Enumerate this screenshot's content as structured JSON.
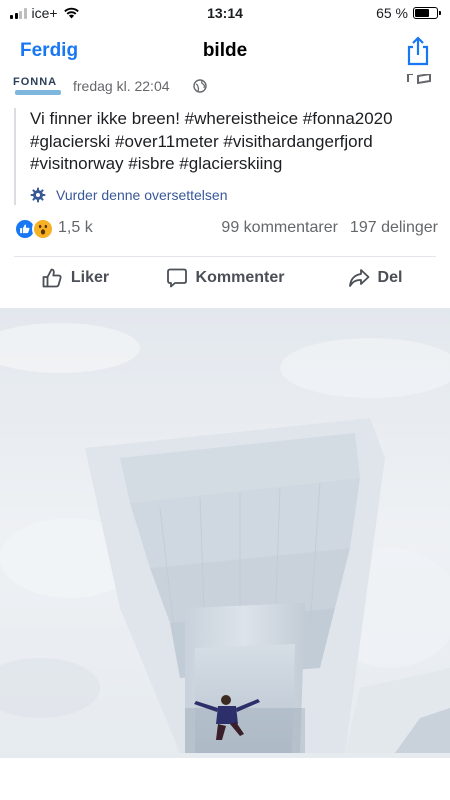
{
  "status_bar": {
    "carrier": "ice+",
    "time": "13:14",
    "battery": "65 %",
    "battery_level": 0.65
  },
  "nav": {
    "done_label": "Ferdig",
    "title": "bilde"
  },
  "post": {
    "page_logo_text": "FONNA",
    "timestamp": "fredag kl. 22:04",
    "body": "Vi finner ikke breen! #whereistheice #fonna2020 #glacierski #over11meter #visithardangerfjord #visitnorway #isbre #glacierskiing",
    "translate_label": "Vurder denne oversettelsen"
  },
  "reactions": {
    "count": "1,5 k",
    "comments": "99 kommentarer",
    "shares": "197 delinger"
  },
  "actions": {
    "like_label": "Liker",
    "comment_label": "Kommenter",
    "share_label": "Del"
  },
  "colors": {
    "accent": "#1877f2",
    "link": "#385898",
    "muted": "#65676b"
  },
  "icons": [
    "signal-icon",
    "wifi-icon",
    "battery-icon",
    "share-icon",
    "globe-icon",
    "menu-icon",
    "gear-icon",
    "like-reaction-icon",
    "wow-reaction-icon",
    "thumbs-up-icon",
    "comment-icon",
    "share-arrow-icon"
  ]
}
